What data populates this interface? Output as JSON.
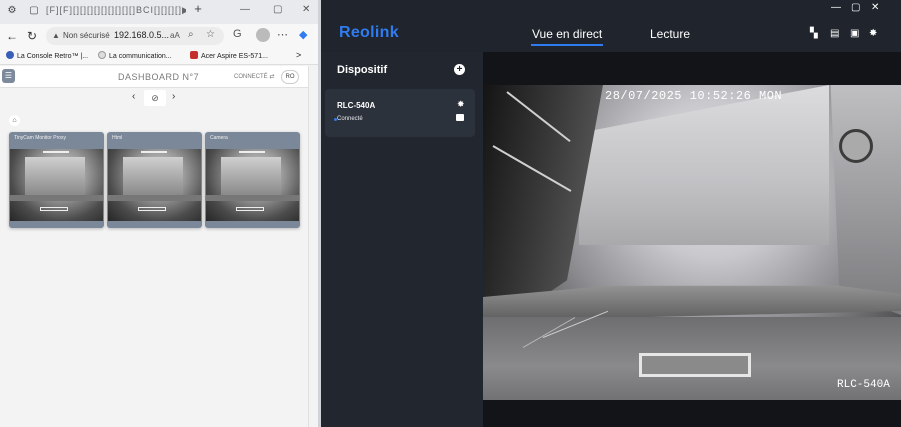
{
  "browser": {
    "tab_title": "[F][F][][][][][][][][][]BCI[][][][]▶[][]▶▶[]|",
    "new_tab": "+",
    "url": {
      "security_label": "Non sécurisé",
      "text": "192.168.0.5...",
      "reader": "aA"
    },
    "bookmarks": [
      {
        "label": "La Console Retro™ |...",
        "color": "#3a5fb8"
      },
      {
        "label": "La communication...",
        "color": "#e0e0e0"
      },
      {
        "label": "Acer Aspire ES-571...",
        "color": "#c4302b"
      }
    ],
    "bookmarks_more": ">"
  },
  "dashboard": {
    "title": "DASHBOARD N°7",
    "connect_label": "CONNECTÉ",
    "user_badge": "RO",
    "cameras": [
      {
        "title": "TinyCam Monitor Proxy"
      },
      {
        "title": "Html"
      },
      {
        "title": "Camera"
      }
    ]
  },
  "reolink": {
    "logo": "Reolink",
    "tabs": [
      {
        "label": "Vue en direct",
        "active": true
      },
      {
        "label": "Lecture",
        "active": false
      }
    ],
    "sidebar": {
      "title": "Dispositif",
      "device": {
        "name": "RLC-540A",
        "status": "Connecté"
      }
    },
    "live": {
      "timestamp": "28/07/2025 10:52:26 MON",
      "camera_name": "RLC-540A"
    },
    "accent_color": "#2f7bf0"
  }
}
